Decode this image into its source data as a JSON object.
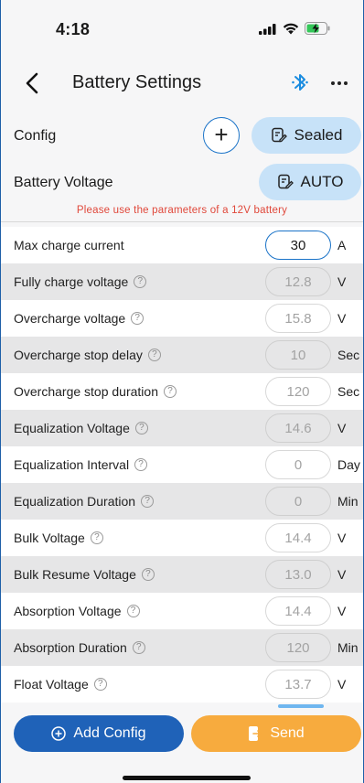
{
  "status": {
    "time": "4:18"
  },
  "nav": {
    "title": "Battery Settings",
    "bluetooth_icon": "bluetooth-icon",
    "more_icon": "more-icon",
    "back_icon": "chevron-left-icon"
  },
  "config": {
    "label": "Config",
    "add_icon": "plus-icon",
    "preset_label": "Sealed",
    "preset_icon": "edit-doc-icon",
    "voltage_label": "Battery Voltage",
    "voltage_value": "AUTO",
    "warning": "Please use the parameters of a 12V battery"
  },
  "params": [
    {
      "label": "Max charge current",
      "value": "30",
      "unit": "A",
      "help": false,
      "active": true
    },
    {
      "label": "Fully charge voltage",
      "value": "12.8",
      "unit": "V",
      "help": true,
      "active": false
    },
    {
      "label": "Overcharge voltage",
      "value": "15.8",
      "unit": "V",
      "help": true,
      "active": false
    },
    {
      "label": "Overcharge stop delay",
      "value": "10",
      "unit": "Sec",
      "help": true,
      "active": false
    },
    {
      "label": "Overcharge stop duration",
      "value": "120",
      "unit": "Sec",
      "help": true,
      "active": false
    },
    {
      "label": "Equalization Voltage",
      "value": "14.6",
      "unit": "V",
      "help": true,
      "active": false
    },
    {
      "label": "Equalization Interval",
      "value": "0",
      "unit": "Day",
      "help": true,
      "active": false
    },
    {
      "label": "Equalization Duration",
      "value": "0",
      "unit": "Min",
      "help": true,
      "active": false
    },
    {
      "label": "Bulk Voltage",
      "value": "14.4",
      "unit": "V",
      "help": true,
      "active": false
    },
    {
      "label": "Bulk Resume Voltage",
      "value": "13.0",
      "unit": "V",
      "help": true,
      "active": false
    },
    {
      "label": "Absorption Voltage",
      "value": "14.4",
      "unit": "V",
      "help": true,
      "active": false
    },
    {
      "label": "Absorption Duration",
      "value": "120",
      "unit": "Min",
      "help": true,
      "active": false
    },
    {
      "label": "Float Voltage",
      "value": "13.7",
      "unit": "V",
      "help": true,
      "active": false
    }
  ],
  "footer": {
    "add_label": "Add Config",
    "add_icon": "plus-circle-icon",
    "send_label": "Send",
    "send_icon": "send-icon"
  },
  "colors": {
    "accent": "#1a73c8",
    "primary_button": "#1f62b8",
    "send_button": "#f7ab3e",
    "pill": "#c7e2f8",
    "warning": "#e0483b"
  }
}
